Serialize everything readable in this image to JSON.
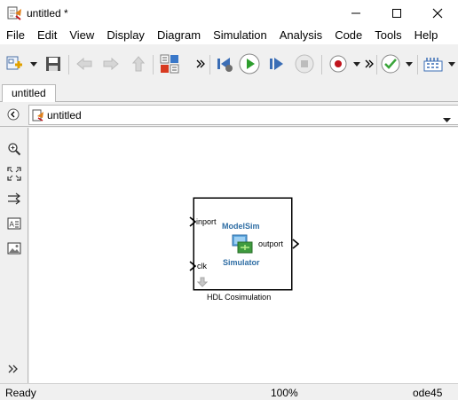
{
  "window": {
    "title": "untitled *"
  },
  "menu": [
    "File",
    "Edit",
    "View",
    "Display",
    "Diagram",
    "Simulation",
    "Analysis",
    "Code",
    "Tools",
    "Help"
  ],
  "tabs": [
    {
      "label": "untitled"
    }
  ],
  "address": {
    "path": "untitled"
  },
  "block": {
    "inport_label": "inport",
    "clk_label": "clk",
    "outport_label": "outport",
    "brand_top": "ModelSim",
    "brand_bottom": "Simulator",
    "name": "HDL Cosimulation"
  },
  "status": {
    "ready": "Ready",
    "zoom": "100%",
    "solver": "ode45"
  },
  "icons": {
    "app": "simulink-model-icon",
    "run_color": "#2e9e2e",
    "record_color": "#c0141c",
    "check_color": "#3aa53a",
    "brand_color": "#2e6da4"
  }
}
